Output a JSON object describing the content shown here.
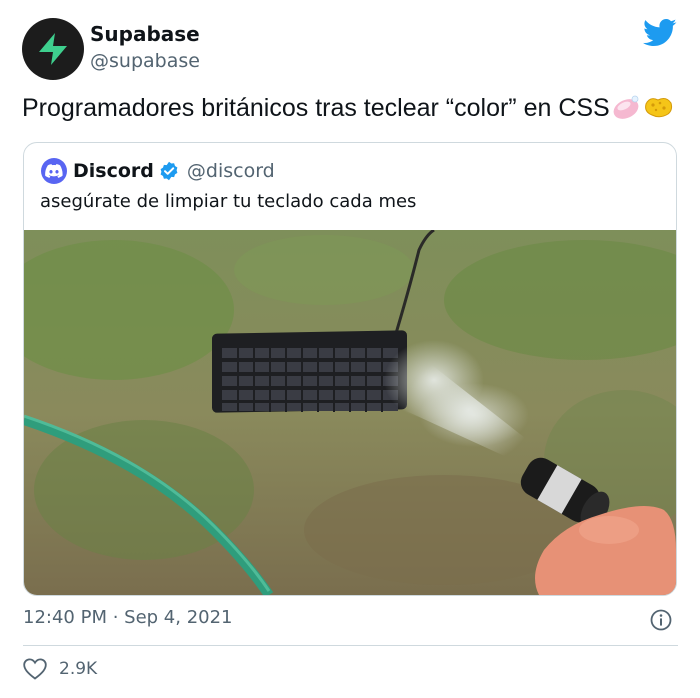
{
  "author": {
    "name": "Supabase",
    "handle": "@supabase",
    "avatar_icon": "supabase-bolt-icon",
    "brand_color": "#3ecf8e"
  },
  "tweet": {
    "text": "Programadores británicos tras teclear “color” en CSS",
    "emojis": [
      "soap-emoji",
      "sponge-emoji"
    ]
  },
  "quoted": {
    "name": "Discord",
    "handle": "@discord",
    "verified": true,
    "text": "asegúrate de limpiar tu teclado cada mes",
    "brand_color": "#5865f2",
    "media_description_icon": "keyboard-hose-photo"
  },
  "meta": {
    "timestamp": "12:40 PM · Sep 4, 2021"
  },
  "actions": {
    "like_count": "2.9K"
  },
  "colors": {
    "twitter_blue": "#1d9bf0",
    "secondary_text": "#536471",
    "border": "#cfd9de"
  }
}
